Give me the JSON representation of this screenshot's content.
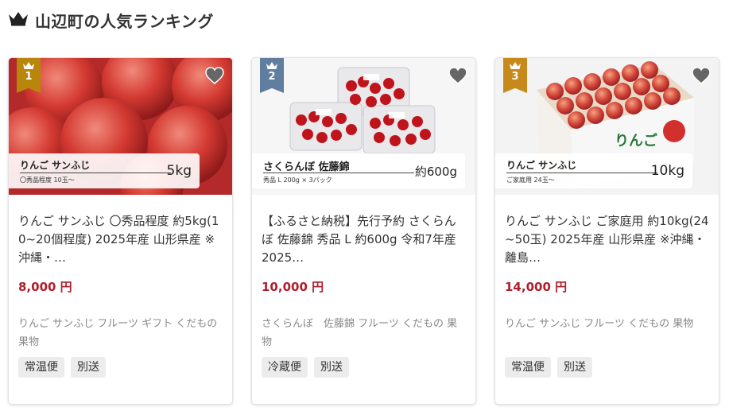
{
  "heading": {
    "icon": "crown-icon",
    "title": "山辺町の人気ランキング"
  },
  "colors": {
    "price": "#b01e2d",
    "rank_1": "#b8860b",
    "rank_2": "#5f7ea0",
    "rank_3": "#c78a1a",
    "favorite": "#666666",
    "chip_bg": "#ececec"
  },
  "cards": [
    {
      "rank": "1",
      "image_label": {
        "name": "りんご サンふじ",
        "sub": "〇秀品程度 10玉～",
        "weight": "5kg"
      },
      "title": "りんご サンふじ 〇秀品程度 約5kg(10~20個程度) 2025年産 山形県産 ※沖縄・…",
      "price": "8,000 円",
      "tags": "りんご サンふじ フルーツ ギフト くだもの 果物",
      "chips": [
        "常温便",
        "別送"
      ]
    },
    {
      "rank": "2",
      "image_label": {
        "name": "さくらんぼ 佐藤錦",
        "sub": "秀品 L 200g × 3パック",
        "weight": "約600g"
      },
      "title": "【ふるさと納税】先行予約 さくらんぼ 佐藤錦 秀品 L 約600g 令和7年産 2025…",
      "price": "10,000 円",
      "tags": "さくらんぼ　佐藤錦 フルーツ くだもの 果物",
      "chips": [
        "冷蔵便",
        "別送"
      ]
    },
    {
      "rank": "3",
      "image_label": {
        "name": "りんご サンふじ",
        "sub": "ご家庭用 24玉～",
        "weight": "10kg"
      },
      "title": "りんご サンふじ ご家庭用 約10kg(24~50玉) 2025年産 山形県産 ※沖縄・離島…",
      "price": "14,000 円",
      "tags": "りんご サンふじ フルーツ くだもの 果物",
      "chips": [
        "常温便",
        "別送"
      ]
    }
  ]
}
